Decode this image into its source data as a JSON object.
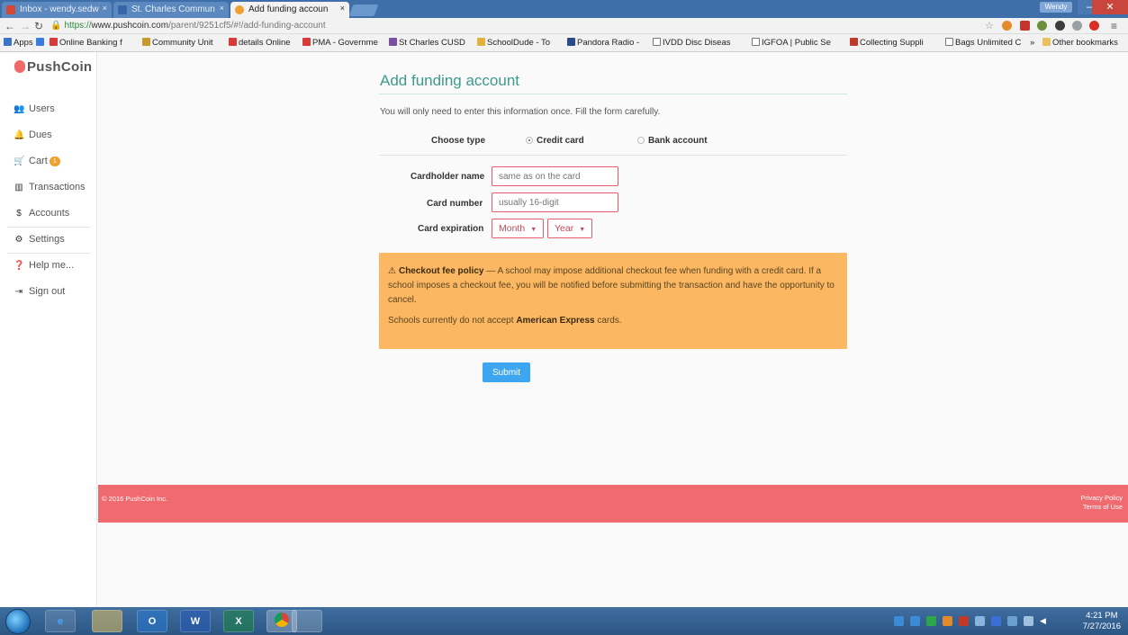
{
  "browser": {
    "tabs": [
      {
        "title": "Inbox - wendy.sedw",
        "icon_color": "#d44638"
      },
      {
        "title": "St. Charles Commun",
        "icon_color": "#3a64a8"
      },
      {
        "title": "Add funding accoun",
        "icon_color": "#f0a02e"
      }
    ],
    "close_glyph": "×",
    "user": "Wendy",
    "url": {
      "scheme": "https://",
      "host": "www.pushcoin.com",
      "path": "/parent/9251cf5/#!/add-funding-account"
    },
    "bookmarks": [
      "Apps",
      "Online Banking f",
      "Community Unit",
      "details Online",
      "PMA - Governme",
      "St Charles CUSD",
      "SchoolDude - To",
      "Pandora Radio -",
      "IVDD Disc Diseas",
      "IGFOA | Public Se",
      "Collecting Suppli",
      "Bags Unlimited C"
    ],
    "more_bookmarks": "»",
    "other_bookmarks": "Other bookmarks"
  },
  "sidebar": {
    "logo": "PushCoin",
    "items": [
      {
        "label": "Users",
        "icon": "users-icon"
      },
      {
        "label": "Dues",
        "icon": "bell-icon"
      },
      {
        "label": "Cart",
        "icon": "cart-icon",
        "badge": "1"
      },
      {
        "label": "Transactions",
        "icon": "bar-chart-icon"
      },
      {
        "label": "Accounts",
        "icon": "dollar-icon"
      },
      {
        "label": "Settings",
        "icon": "gears-icon"
      },
      {
        "label": "Help me...",
        "icon": "help-icon"
      },
      {
        "label": "Sign out",
        "icon": "sign-out-icon"
      }
    ]
  },
  "form": {
    "title": "Add funding account",
    "intro": "You will only need to enter this information once. Fill the form carefully.",
    "choose_type_label": "Choose type",
    "type_options": [
      "Credit card",
      "Bank account"
    ],
    "selected_type": "Credit card",
    "cardholder_label": "Cardholder name",
    "cardholder_placeholder": "same as on the card",
    "card_number_label": "Card number",
    "card_number_placeholder": "usually 16-digit",
    "expiration_label": "Card expiration",
    "month_value": "Month",
    "year_value": "Year",
    "caret": "▼",
    "alert_title": "Checkout fee policy",
    "alert_body": " — A school may impose additional checkout fee when funding with a credit card. If a school imposes a checkout fee, you will be notified before submitting the transaction and have the opportunity to cancel.",
    "amex_prefix": "Schools currently do not accept ",
    "amex_brand": "American Express",
    "amex_suffix": " cards.",
    "submit_label": "Submit"
  },
  "footer": {
    "copyright": "© 2016 PushCoin Inc.",
    "privacy": "Privacy Policy",
    "terms": "Terms of Use"
  },
  "taskbar": {
    "time": "4:21 PM",
    "date": "7/27/2016"
  },
  "colors": {
    "accent": "#3c9a8c",
    "error_border": "#e55c6a",
    "alert_bg": "#fbb762",
    "footer_bg": "#ef6b70",
    "submit_bg": "#3ea6f0"
  }
}
